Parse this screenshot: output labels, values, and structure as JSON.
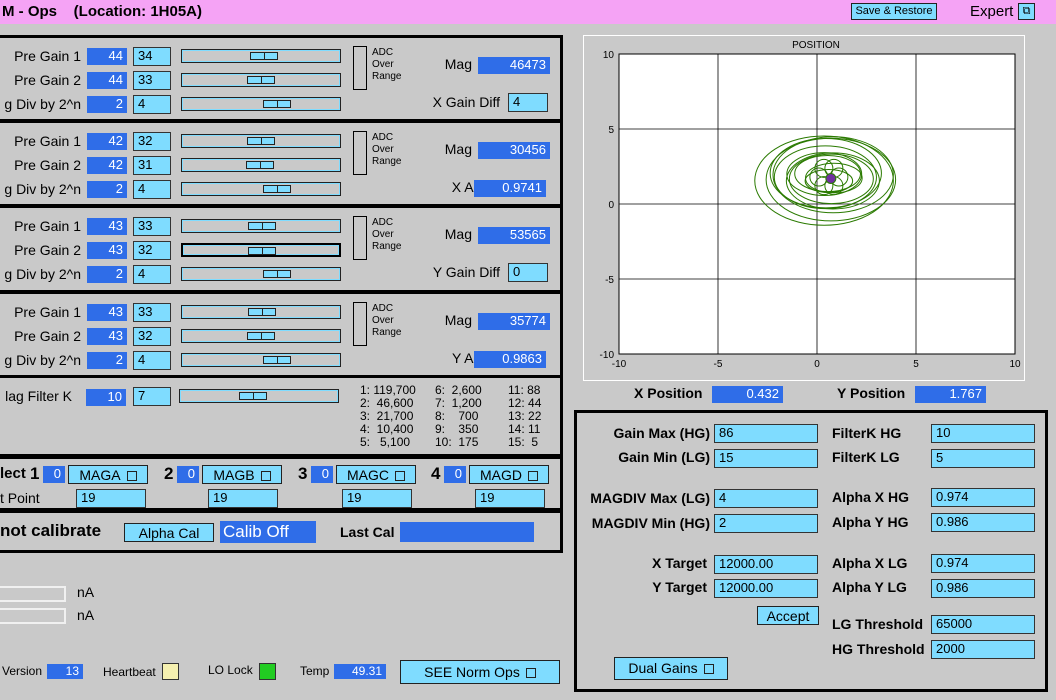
{
  "titlebar": {
    "title": "M - Ops    (Location: 1H05A)",
    "save_restore": "Save & Restore",
    "expert": "Expert",
    "expert_icon": "window-icon"
  },
  "channels": [
    {
      "pre1_label": "Pre Gain 1",
      "pre1_set": "44",
      "pre1_rb": "34",
      "pre1_slider": 0.52,
      "pre2_label": "Pre Gain 2",
      "pre2_set": "44",
      "pre2_rb": "33",
      "pre2_slider": 0.5,
      "div_label": "g Div by 2^n",
      "div_set": "2",
      "div_rb": "4",
      "div_slider": 0.62,
      "mag_label": "Mag",
      "mag": "46473",
      "extra_label": "X Gain Diff",
      "extra": "4",
      "extra_style": "cyan"
    },
    {
      "pre1_label": "Pre Gain 1",
      "pre1_set": "42",
      "pre1_rb": "32",
      "pre1_slider": 0.5,
      "pre2_label": "Pre Gain 2",
      "pre2_set": "42",
      "pre2_rb": "31",
      "pre2_slider": 0.49,
      "div_label": "g Div by 2^n",
      "div_set": "2",
      "div_rb": "4",
      "div_slider": 0.62,
      "mag_label": "Mag",
      "mag": "30456",
      "extra_label": "X Alpha",
      "extra": "0.9741",
      "extra_style": "blue"
    },
    {
      "pre1_label": "Pre Gain 1",
      "pre1_set": "43",
      "pre1_rb": "33",
      "pre1_slider": 0.51,
      "pre2_label": "Pre Gain 2",
      "pre2_set": "43",
      "pre2_rb": "32",
      "pre2_slider": 0.5,
      "div_label": "g Div by 2^n",
      "div_set": "2",
      "div_rb": "4",
      "div_slider": 0.62,
      "mag_label": "Mag",
      "mag": "53565",
      "extra_label": "Y Gain Diff",
      "extra": "0",
      "extra_style": "cyan"
    },
    {
      "pre1_label": "Pre Gain 1",
      "pre1_set": "43",
      "pre1_rb": "33",
      "pre1_slider": 0.51,
      "pre2_label": "Pre Gain 2",
      "pre2_set": "43",
      "pre2_rb": "32",
      "pre2_slider": 0.5,
      "div_label": "g Div by 2^n",
      "div_set": "2",
      "div_rb": "4",
      "div_slider": 0.62,
      "mag_label": "Mag",
      "mag": "35774",
      "extra_label": "Y Alpha",
      "extra": "0.9863",
      "extra_style": "blue"
    }
  ],
  "adc": [
    "ADC",
    "Over",
    "Range"
  ],
  "filter": {
    "label": "lag Filter K",
    "set": "10",
    "rb": "7",
    "slider": 0.45,
    "table": [
      [
        "1: 119,700",
        "6:  2,600",
        "11: 88"
      ],
      [
        "2:  46,600",
        "7:  1,200",
        "12: 44"
      ],
      [
        "3:  21,700",
        "8:    700",
        "13: 22"
      ],
      [
        "4:  10,400",
        "9:    350",
        "14: 11"
      ],
      [
        "5:   5,100",
        "10:  175",
        "15:  5"
      ]
    ]
  },
  "select": {
    "label": "lect",
    "point_label": "t Point",
    "items": [
      {
        "num": "1",
        "val": "0",
        "btn": "MAGA",
        "point": "19"
      },
      {
        "num": "2",
        "val": "0",
        "btn": "MAGB",
        "point": "19"
      },
      {
        "num": "3",
        "val": "0",
        "btn": "MAGC",
        "point": "19"
      },
      {
        "num": "4",
        "val": "0",
        "btn": "MAGD",
        "point": "19"
      }
    ]
  },
  "calib": {
    "status": "not calibrate",
    "alpha_btn": "Alpha Cal",
    "calib_state": "Calib Off",
    "last_cal_label": "Last Cal",
    "last_cal": ""
  },
  "currents": {
    "unit1": "nA",
    "unit2": "nA"
  },
  "footer": {
    "version_label": "Version",
    "version": "13",
    "heartbeat_label": "Heartbeat",
    "lolock_label": "LO Lock",
    "temp_label": "Temp",
    "temp": "49.31",
    "see_btn": "SEE Norm Ops",
    "heartbeat_color": "#f5f0b0",
    "lolock_color": "#22cc22"
  },
  "chart_data": {
    "type": "scatter",
    "title": "POSITION",
    "xlim": [
      -10,
      10
    ],
    "ylim": [
      -10,
      10
    ],
    "xticks": [
      "-10",
      "-5",
      "0",
      "5",
      "10"
    ],
    "yticks": [
      "-10",
      "-5",
      "0",
      "5",
      "10"
    ],
    "grid": true,
    "series": [
      {
        "values": [
          [
            0.6,
            1.8
          ]
        ],
        "color": "#2a7a00",
        "orbit_radius_x": [
          1.2,
          3.5
        ],
        "orbit_radius_y": [
          0.9,
          3.5
        ]
      },
      {
        "values": [
          [
            0.7,
            1.7
          ]
        ],
        "color": "#7030a0"
      }
    ]
  },
  "position": {
    "x_label": "X Position",
    "x": "0.432",
    "y_label": "Y Position",
    "y": "1.767"
  },
  "settings": {
    "gain_max_label": "Gain Max (HG)",
    "gain_max": "86",
    "gain_min_label": "Gain Min (LG)",
    "gain_min": "15",
    "magdiv_max_label": "MAGDIV Max (LG)",
    "magdiv_max": "4",
    "magdiv_min_label": "MAGDIV Min (HG)",
    "magdiv_min": "2",
    "xtarget_label": "X Target",
    "xtarget": "12000.00",
    "ytarget_label": "Y Target",
    "ytarget": "12000.00",
    "accept": "Accept",
    "filterk_hg_label": "FilterK HG",
    "filterk_hg": "10",
    "filterk_lg_label": "FilterK LG",
    "filterk_lg": "5",
    "alphax_hg_label": "Alpha X HG",
    "alphax_hg": "0.974",
    "alphay_hg_label": "Alpha Y HG",
    "alphay_hg": "0.986",
    "alphax_lg_label": "Alpha X LG",
    "alphax_lg": "0.974",
    "alphay_lg_label": "Alpha Y LG",
    "alphay_lg": "0.986",
    "lg_thr_label": "LG Threshold",
    "lg_thr": "65000",
    "hg_thr_label": "HG Threshold",
    "hg_thr": "2000",
    "dual_gains": "Dual Gains"
  }
}
